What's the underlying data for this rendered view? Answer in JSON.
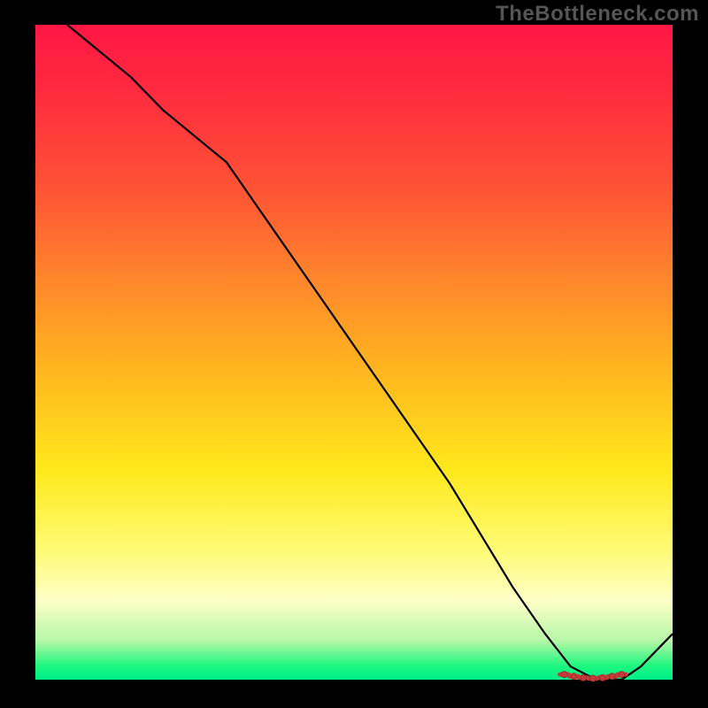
{
  "watermark": "TheBottleneck.com",
  "chart_data": {
    "type": "line",
    "title": "",
    "xlabel": "",
    "ylabel": "",
    "xlim": [
      0,
      100
    ],
    "ylim": [
      0,
      100
    ],
    "grid": false,
    "series": [
      {
        "name": "curve",
        "x": [
          5,
          10,
          15,
          20,
          25,
          30,
          35,
          40,
          45,
          50,
          55,
          60,
          65,
          70,
          75,
          80,
          84,
          88,
          92,
          95,
          100
        ],
        "y": [
          100,
          96,
          92,
          87,
          83,
          79,
          72,
          65,
          58,
          51,
          44,
          37,
          30,
          22,
          14,
          7,
          2,
          0,
          0,
          2,
          7
        ]
      }
    ],
    "highlighted_points": {
      "x": [
        83,
        84.5,
        86,
        87.5,
        89,
        90.5,
        92
      ],
      "y": [
        0.8,
        0.5,
        0.3,
        0.2,
        0.3,
        0.5,
        0.8
      ]
    },
    "background_gradient": {
      "top": "#ff1744",
      "mid": "#ffe81c",
      "bottom": "#00ef8a"
    }
  }
}
